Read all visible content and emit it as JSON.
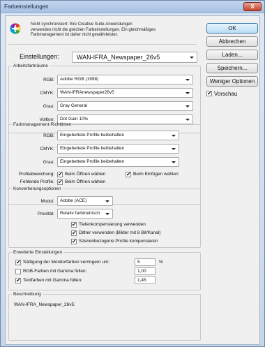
{
  "window": {
    "title": "Farbeinstellungen",
    "close_label": "X"
  },
  "sync": {
    "line1": "Nicht synchronisiert: Ihre Creative Suite-Anwendungen",
    "line2": "verwenden nicht die gleichen Farbeinstellungen. Ein gleichmäßiges",
    "line3": "Farbmanagement ist daher nicht gewährleistet."
  },
  "settings": {
    "label": "Einstellungen:",
    "value": "WAN-IFRA_Newspaper_26v5"
  },
  "arbeitsfarbraeume": {
    "legend": "Arbeitsfarbräume",
    "rgb_label": "RGB:",
    "rgb_value": "Adobe RGB (1998)",
    "cmyk_label": "CMYK:",
    "cmyk_value": "WAN-IFRAnewspaper26v5",
    "grau_label": "Grau:",
    "grau_value": "Gray General",
    "volton_label": "Vollton:",
    "volton_value": "Dot Gain 10%"
  },
  "richtlinien": {
    "legend": "Farbmanagement-Richtlinien",
    "rgb_label": "RGB:",
    "rgb_value": "Eingebettete Profile beibehalten",
    "cmyk_label": "CMYK:",
    "cmyk_value": "Eingebettete Profile beibehalten",
    "grau_label": "Grau:",
    "grau_value": "Eingebettete Profile beibehalten",
    "profilabweichung_label": "Profilabweichung:",
    "beim_oeffnen_1": "Beim Öffnen wählen",
    "beim_einfuegen": "Beim Einfügen wählen",
    "fehlende_label": "Fehlende Profile:",
    "beim_oeffnen_2": "Beim Öffnen wählen"
  },
  "konvertierung": {
    "legend": "Konvertierungsoptionen",
    "modul_label": "Modul:",
    "modul_value": "Adobe (ACE)",
    "prioritaet_label": "Priorität:",
    "prioritaet_value": "Relativ farbmetrisch",
    "tiefen": "Tiefenkompensierung verwenden",
    "dither": "Dither verwenden (Bilder mit 8 Bit/Kanal)",
    "szenen": "Szenenbezogene Profile kompensieren"
  },
  "erweitert": {
    "legend": "Erweiterte Einstellungen",
    "saettigung": "Sättigung der Monitorfarben verringern um:",
    "saettigung_value": "5",
    "saettigung_unit": "%",
    "rgb_gamma": "RGB-Farben mit Gamma füllen:",
    "rgb_gamma_value": "1,00",
    "text_gamma": "Textfarben mit Gamma füllen:",
    "text_gamma_value": "1,45"
  },
  "beschreibung": {
    "legend": "Beschreibung",
    "text": "WAN-IFRA_Newspaper_26v5:"
  },
  "buttons": {
    "ok": "OK",
    "abbrechen": "Abbrechen",
    "laden": "Laden...",
    "speichern": "Speichern...",
    "weniger": "Weniger Optionen",
    "vorschau": "Vorschau"
  }
}
